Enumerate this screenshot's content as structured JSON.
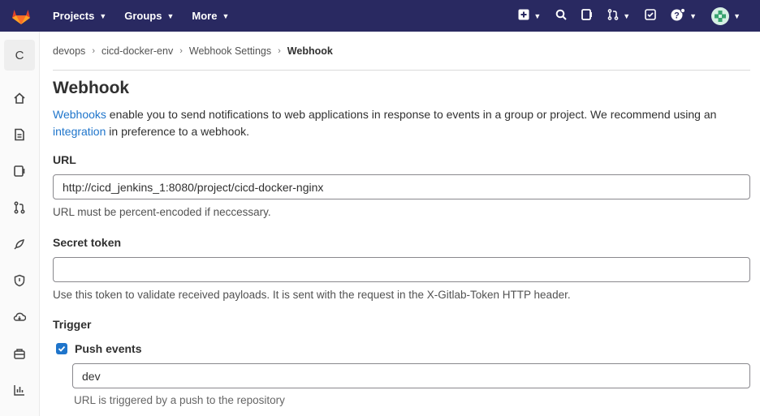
{
  "topbar": {
    "nav": [
      {
        "label": "Projects"
      },
      {
        "label": "Groups"
      },
      {
        "label": "More"
      }
    ],
    "icons": [
      "plus-square-icon",
      "search-icon",
      "issues-icon",
      "merge-request-icon",
      "todo-icon",
      "help-icon",
      "user-avatar"
    ]
  },
  "sidebar": {
    "project_initial": "C",
    "items": [
      "home-icon",
      "repository-icon",
      "issues-icon",
      "merge-requests-icon",
      "cicd-icon",
      "security-icon",
      "deployments-icon",
      "packages-icon",
      "analytics-icon"
    ]
  },
  "breadcrumb": {
    "items": [
      "devops",
      "cicd-docker-env",
      "Webhook Settings"
    ],
    "current": "Webhook"
  },
  "page": {
    "title": "Webhook",
    "intro_link": "Webhooks",
    "intro_text_1": " enable you to send notifications to web applications in response to events in a group or project. We recommend using an",
    "intro_link_2": "integration",
    "intro_text_2": " in preference to a webhook."
  },
  "url": {
    "label": "URL",
    "value": "http://cicd_jenkins_1:8080/project/cicd-docker-nginx",
    "help": "URL must be percent-encoded if neccessary."
  },
  "secret": {
    "label": "Secret token",
    "value": "",
    "help": "Use this token to validate received payloads. It is sent with the request in the X-Gitlab-Token HTTP header."
  },
  "trigger": {
    "label": "Trigger",
    "push_events": {
      "label": "Push events",
      "checked": true,
      "branch_value": "dev",
      "help": "URL is triggered by a push to the repository"
    }
  },
  "colors": {
    "topbar": "#292961",
    "link": "#1f75cb",
    "checkbox": "#1f75cb"
  }
}
